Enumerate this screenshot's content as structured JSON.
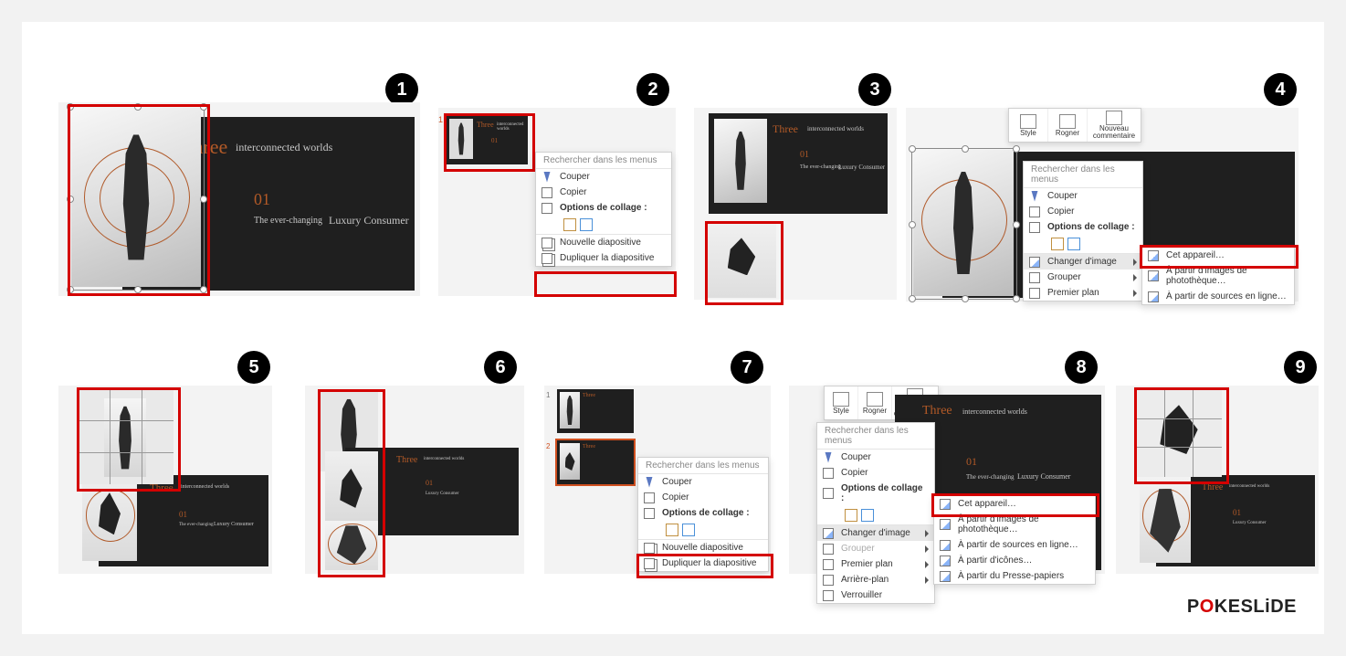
{
  "steps": [
    "1",
    "2",
    "3",
    "4",
    "5",
    "6",
    "7",
    "8",
    "9"
  ],
  "slide": {
    "title_big": "Three",
    "title_sub": "interconnected worlds",
    "num": "01",
    "body_prefix": "The ever-changing ",
    "body_em": "Luxury Consumer"
  },
  "toolbar": {
    "style": "Style",
    "crop": "Rogner",
    "comment": "Nouveau\ncommentaire"
  },
  "ctx": {
    "search": "Rechercher dans les menus",
    "cut": "Couper",
    "copy": "Copier",
    "paste_opts": "Options de collage :",
    "new_slide": "Nouvelle diapositive",
    "dup_slide": "Dupliquer la diapositive",
    "change_img": "Changer d'image",
    "group": "Grouper",
    "front": "Premier plan",
    "back": "Arrière-plan",
    "lock": "Verrouiller"
  },
  "sub": {
    "device": "Cet appareil…",
    "stock": "À partir d'images de photothèque…",
    "online": "À partir de sources en ligne…",
    "icons": "À partir d'icônes…",
    "clipboard": "À partir du Presse-papiers"
  },
  "logo": {
    "p1": "P",
    "o": "O",
    "p2": "KESL",
    "i": "i",
    "p3": "DE"
  }
}
